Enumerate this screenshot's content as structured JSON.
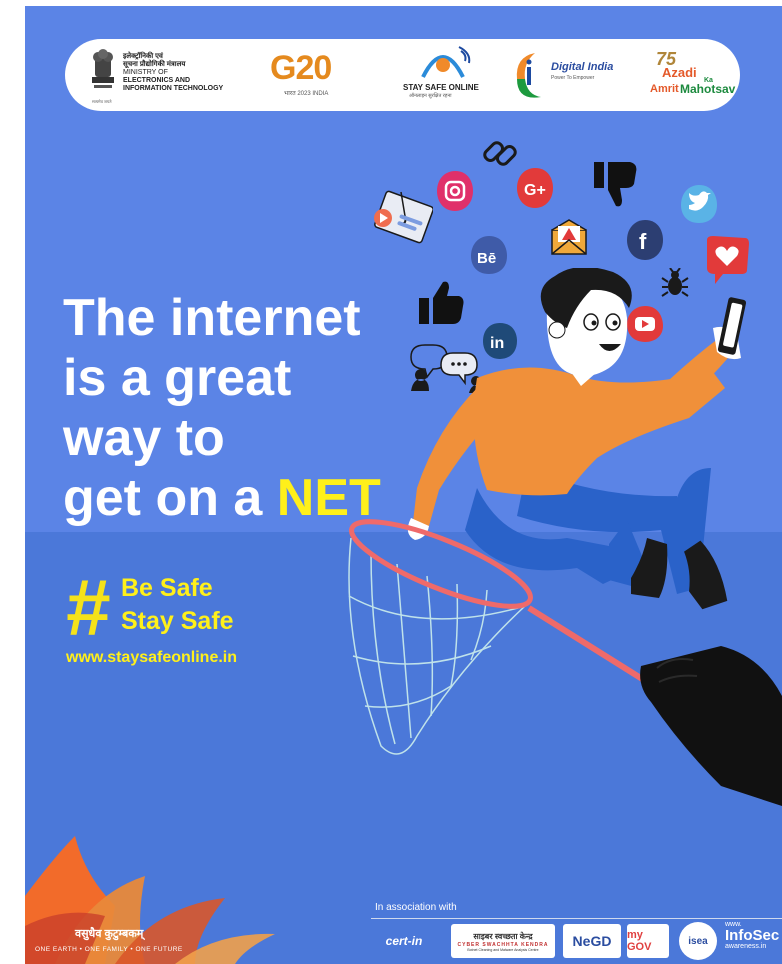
{
  "header": {
    "meity": {
      "line1": "इलेक्ट्रॉनिकी एवं",
      "line2": "सूचना प्रौद्योगिकी मंत्रालय",
      "line3": "MINISTRY OF",
      "line4": "ELECTRONICS AND",
      "line5": "INFORMATION TECHNOLOGY",
      "emblem_motto": "सत्यमेव जयते"
    },
    "g20": {
      "logo": "G20",
      "subtitle": "भारत 2023 INDIA"
    },
    "stay_safe": {
      "title": "STAY SAFE ONLINE",
      "subtitle": "ऑनलाइन सुरक्षित रहना"
    },
    "digital_india": {
      "title": "Digital India",
      "tagline": "Power To Empower"
    },
    "azadi": {
      "line1": "Azadi",
      "ka": "Ka",
      "amrit": "Amrit",
      "mahotsav": "Mahotsav",
      "number": "75"
    }
  },
  "headline": {
    "line1": "The internet",
    "line2": "is a great",
    "line3": "way to",
    "line4_prefix": "get on a ",
    "highlight": "NET"
  },
  "hashtag": {
    "symbol": "#",
    "line1": "Be Safe",
    "line2": "Stay Safe"
  },
  "website": "www.staysafeonline.in",
  "social_icons": [
    "hyperlink-icon",
    "instagram-icon",
    "google-plus-icon",
    "thumbs-down-icon",
    "twitter-icon",
    "email-warning-icon",
    "facebook-icon",
    "behance-icon",
    "heart-icon",
    "bug-icon",
    "thumbs-up-icon",
    "linkedin-icon",
    "youtube-icon",
    "chat-icon",
    "phishing-video-icon"
  ],
  "footer": {
    "vasudhaiva": "वसुधैव कुटुम्बकम्",
    "one_earth": "ONE EARTH • ONE FAMILY • ONE FUTURE",
    "association": "In association with",
    "partners": {
      "cert": "cert-in",
      "csk_hindi": "साइबर स्वच्छता केन्द्र",
      "csk_english": "CYBER SWACHHTA KENDRA",
      "csk_sub": "Botnet Cleaning and Malware Analysis Centre",
      "negd": "NeGD",
      "mygov": "my GOV",
      "isea": "isea",
      "infosec_www": "www.",
      "infosec": "InfoSec",
      "infosec_domain": "awareness.in"
    }
  },
  "colors": {
    "background_upper": "#5b84e6",
    "background_lower": "#4b78d9",
    "highlight": "#fff01a",
    "shirt": "#f0903a",
    "trousers": "#2a62c9"
  }
}
